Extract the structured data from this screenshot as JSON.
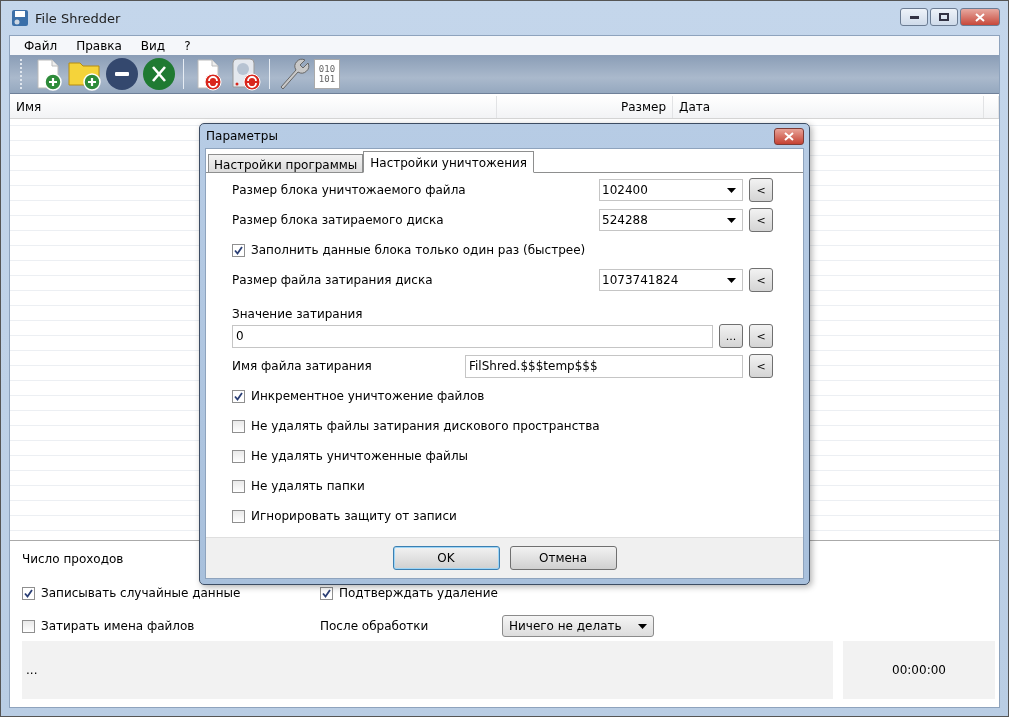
{
  "window": {
    "title": "File Shredder"
  },
  "menu": [
    {
      "label": "Файл"
    },
    {
      "label": "Правка"
    },
    {
      "label": "Вид"
    },
    {
      "label": "?"
    }
  ],
  "toolbar": {
    "groups": [
      [
        {
          "kind": "file-add"
        },
        {
          "kind": "folder-add"
        },
        {
          "kind": "remove"
        },
        {
          "kind": "clear"
        }
      ],
      [
        {
          "kind": "file-shred"
        },
        {
          "kind": "disk-wipe"
        }
      ],
      [
        {
          "kind": "settings"
        },
        {
          "kind": "binary",
          "lines": [
            "010",
            "101"
          ]
        }
      ]
    ]
  },
  "file_list": {
    "columns": [
      {
        "label": "Имя"
      },
      {
        "label": "Размер"
      },
      {
        "label": "Дата"
      }
    ]
  },
  "options": {
    "passes_label": "Число проходов",
    "left": [
      {
        "label": "Записывать случайные данные",
        "checked": true
      },
      {
        "label": "Затирать имена файлов",
        "checked": false
      }
    ],
    "confirm": {
      "label": "Подтверждать удаление",
      "checked": true
    },
    "after_label": "После обработки",
    "after_value": "Ничего не делать"
  },
  "status": {
    "message": "...",
    "time": "00:00:00"
  },
  "dialog": {
    "title": "Параметры",
    "tabs": [
      {
        "label": "Настройки программы",
        "selected": false
      },
      {
        "label": "Настройки уничтожения",
        "selected": true
      }
    ],
    "rows": [
      {
        "kind": "combo",
        "label": "Размер блока уничтожаемого файла",
        "value": "102400",
        "reset": "<"
      },
      {
        "kind": "combo",
        "label": "Размер блока затираемого диска",
        "value": "524288",
        "reset": "<"
      },
      {
        "kind": "checkbox",
        "label": "Заполнить данные блока только один раз (быстрее)",
        "checked": true
      },
      {
        "kind": "combo",
        "label": "Размер файла затирания диска",
        "value": "1073741824",
        "reset": "<"
      },
      {
        "kind": "caption",
        "label": "Значение затирания"
      },
      {
        "kind": "wide_field",
        "value": "0",
        "browse": "...",
        "reset": "<"
      },
      {
        "kind": "field",
        "label": "Имя файла затирания",
        "value": "FilShred.$$$temp$$$",
        "reset": "<"
      },
      {
        "kind": "checkbox",
        "label": "Инкрементное уничтожение файлов",
        "checked": true
      },
      {
        "kind": "checkbox",
        "label": "Не удалять файлы затирания дискового пространства",
        "checked": false
      },
      {
        "kind": "checkbox",
        "label": "Не удалять уничтоженные файлы",
        "checked": false
      },
      {
        "kind": "checkbox",
        "label": "Не удалять папки",
        "checked": false
      },
      {
        "kind": "checkbox",
        "label": "Игнорировать защиту от записи",
        "checked": false
      }
    ],
    "buttons": [
      {
        "label": "OK",
        "default": true
      },
      {
        "label": "Отмена",
        "default": false
      }
    ]
  }
}
